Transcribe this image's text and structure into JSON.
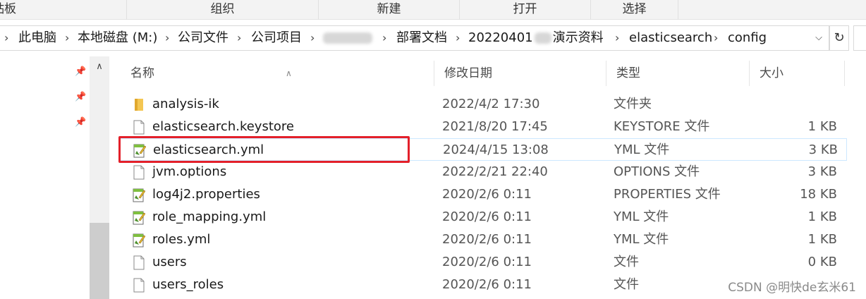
{
  "ribbon": {
    "groups": [
      "剪贴板",
      "组织",
      "新建",
      "打开",
      "选择"
    ]
  },
  "address": {
    "crumbs": [
      "此电脑",
      "本地磁盘 (M:)",
      "公司文件",
      "公司项目",
      "",
      "部署文档",
      "20220401",
      "演示资料",
      "elasticsearch",
      "config"
    ],
    "dropdown_icon": "chevron-down-icon",
    "refresh_icon": "refresh-icon"
  },
  "columns": {
    "name": "名称",
    "date": "修改日期",
    "type": "类型",
    "size": "大小"
  },
  "files": [
    {
      "name": "analysis-ik",
      "date": "2022/4/2 17:30",
      "type": "文件夹",
      "size": "",
      "icon": "folder-icon"
    },
    {
      "name": "elasticsearch.keystore",
      "date": "2021/8/20 17:45",
      "type": "KEYSTORE 文件",
      "size": "1 KB",
      "icon": "file-icon"
    },
    {
      "name": "elasticsearch.yml",
      "date": "2024/4/15 13:08",
      "type": "YML 文件",
      "size": "3 KB",
      "icon": "edit-file-icon"
    },
    {
      "name": "jvm.options",
      "date": "2022/2/21 22:40",
      "type": "OPTIONS 文件",
      "size": "3 KB",
      "icon": "file-icon"
    },
    {
      "name": "log4j2.properties",
      "date": "2020/2/6 0:11",
      "type": "PROPERTIES 文件",
      "size": "18 KB",
      "icon": "edit-file-icon"
    },
    {
      "name": "role_mapping.yml",
      "date": "2020/2/6 0:11",
      "type": "YML 文件",
      "size": "1 KB",
      "icon": "edit-file-icon"
    },
    {
      "name": "roles.yml",
      "date": "2020/2/6 0:11",
      "type": "YML 文件",
      "size": "1 KB",
      "icon": "edit-file-icon"
    },
    {
      "name": "users",
      "date": "2020/2/6 0:11",
      "type": "文件",
      "size": "0 KB",
      "icon": "file-icon"
    },
    {
      "name": "users_roles",
      "date": "2020/2/6 0:11",
      "type": "文件",
      "size": "",
      "icon": "file-icon"
    }
  ],
  "watermark": "CSDN @明快de玄米61",
  "colors": {
    "highlight": "#e3202a",
    "selection": "#cde8ff"
  }
}
